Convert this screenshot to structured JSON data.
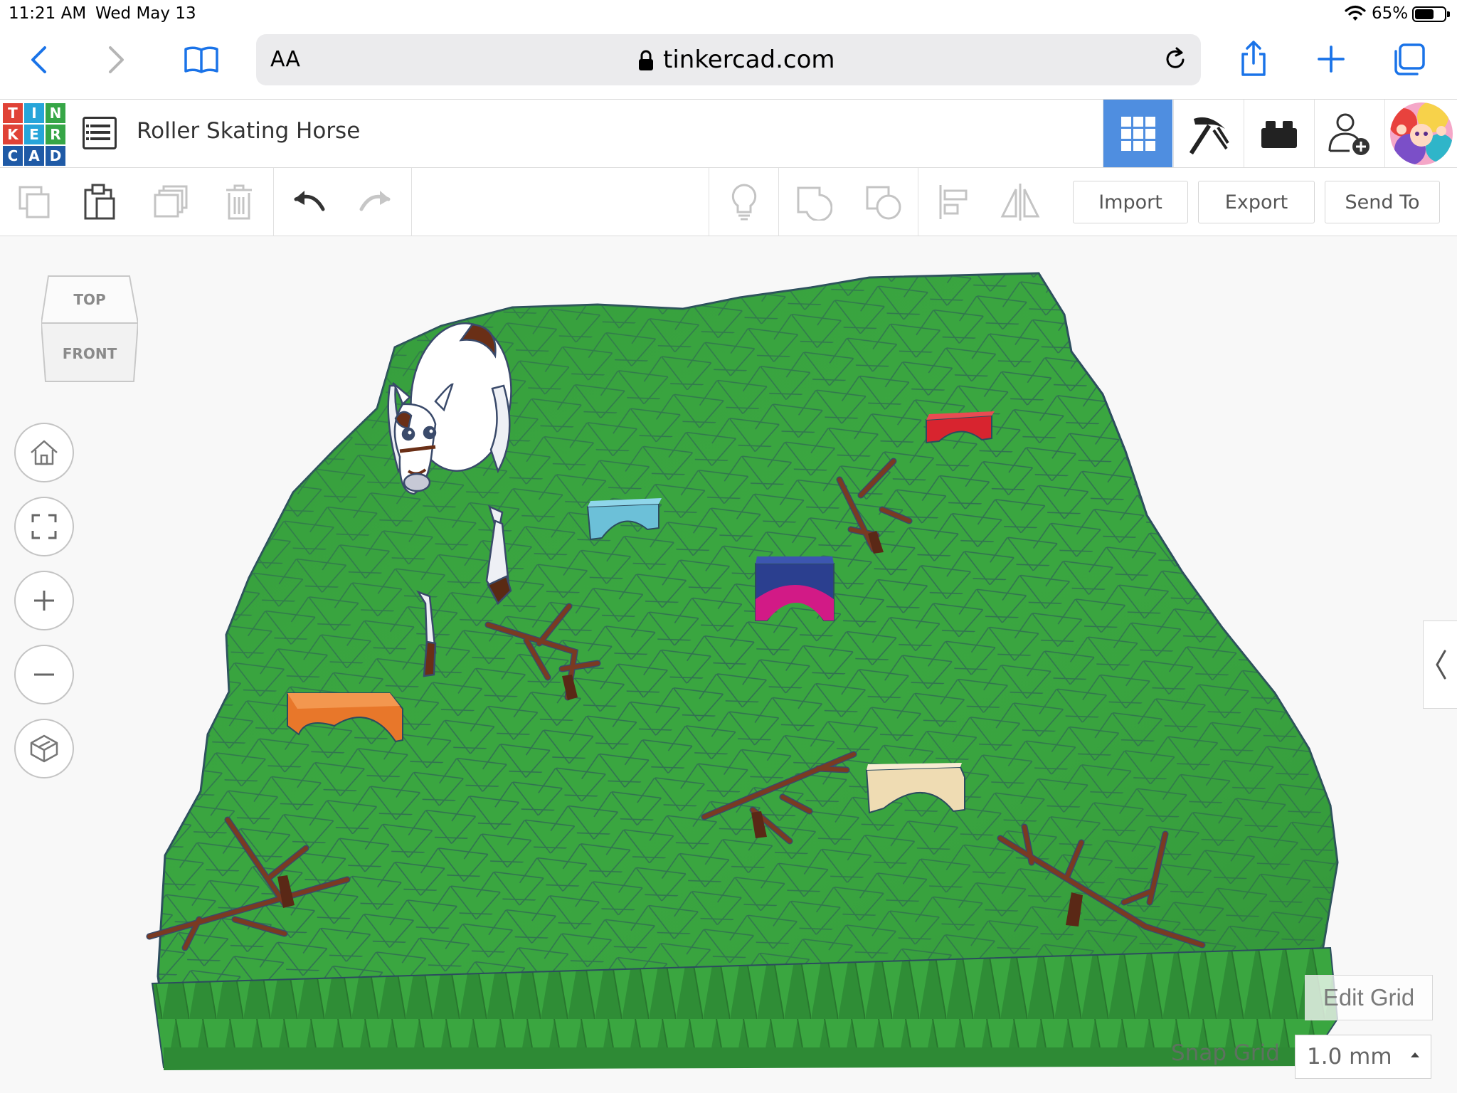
{
  "status_bar": {
    "time": "11:21 AM",
    "date": "Wed May 13",
    "battery": "65%",
    "battery_level": 0.65
  },
  "safari": {
    "text_size_label": "AA",
    "domain": "tinkercad.com",
    "icons": [
      "back-icon",
      "forward-icon",
      "bookmarks-icon",
      "lock-icon",
      "reload-icon",
      "share-icon",
      "plus-icon",
      "tabs-icon"
    ]
  },
  "app": {
    "logo_letters": [
      "T",
      "I",
      "N",
      "K",
      "E",
      "R",
      "C",
      "A",
      "D"
    ],
    "logo_colors": [
      "#e04236",
      "#27a5d9",
      "#36a647",
      "#e04236",
      "#27a5d9",
      "#36a647",
      "#1f5aa6",
      "#1f5aa6",
      "#1f5aa6"
    ],
    "design_title": "Roller Skating Horse",
    "header_icons": [
      "3d-view-grid-icon",
      "codeblocks-pickaxe-icon",
      "bricks-icon",
      "add-user-icon",
      "user-avatar"
    ]
  },
  "toolbar": {
    "import_label": "Import",
    "export_label": "Export",
    "send_to_label": "Send To",
    "icons": [
      "copy-icon",
      "paste-icon",
      "duplicate-icon",
      "delete-icon",
      "undo-icon",
      "redo-icon",
      "lightbulb-icon",
      "group-icon",
      "ungroup-icon",
      "align-icon",
      "mirror-icon"
    ]
  },
  "workplane": {
    "view_cube_top": "TOP",
    "view_cube_front": "FRONT",
    "nav_icons": [
      "home-view-icon",
      "fit-view-icon",
      "zoom-in-icon",
      "zoom-out-icon",
      "orthographic-icon"
    ],
    "edit_grid_label": "Edit Grid",
    "snap_grid_label": "Snap Grid",
    "snap_grid_value": "1.0 mm",
    "colors": {
      "terrain": "#3aa640",
      "terrain_dark": "#2e8a35",
      "terrain_edge": "#2c4c5e"
    },
    "scene_objects": [
      {
        "name": "horse",
        "color": "#ffffff"
      },
      {
        "name": "jump-red",
        "color": "#d8242f"
      },
      {
        "name": "jump-light-blue",
        "color": "#6cc0d8"
      },
      {
        "name": "jump-navy-magenta",
        "color": "#2b3f8f"
      },
      {
        "name": "jump-orange",
        "color": "#e8772a"
      },
      {
        "name": "jump-tan",
        "color": "#efdcb3"
      },
      {
        "name": "tree-branches",
        "color": "#7a3a22"
      }
    ]
  }
}
